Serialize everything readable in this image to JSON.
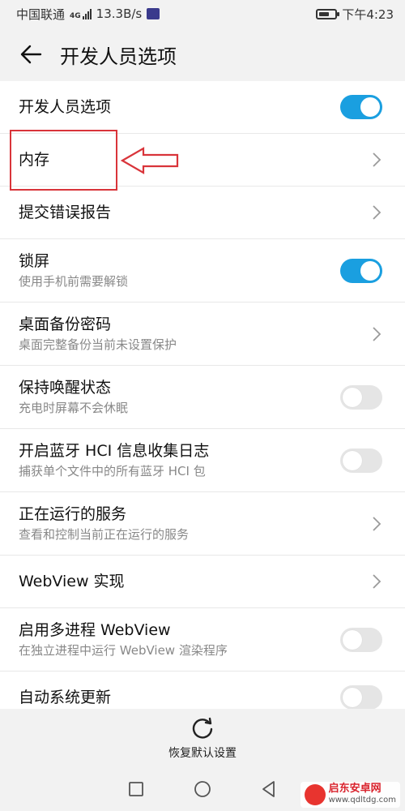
{
  "status_bar": {
    "carrier": "中国联通",
    "network_type": "4G",
    "net_speed": "13.3B/s",
    "time": "下午4:23"
  },
  "app_bar": {
    "title": "开发人员选项"
  },
  "settings": [
    {
      "title": "开发人员选项",
      "subtitle": "",
      "control": "switch",
      "state": "on"
    },
    {
      "title": "内存",
      "subtitle": "",
      "control": "chevron"
    },
    {
      "title": "提交错误报告",
      "subtitle": "",
      "control": "chevron"
    },
    {
      "title": "锁屏",
      "subtitle": "使用手机前需要解锁",
      "control": "switch",
      "state": "on"
    },
    {
      "title": "桌面备份密码",
      "subtitle": "桌面完整备份当前未设置保护",
      "control": "chevron"
    },
    {
      "title": "保持唤醒状态",
      "subtitle": "充电时屏幕不会休眠",
      "control": "switch",
      "state": "off"
    },
    {
      "title": "开启蓝牙 HCI 信息收集日志",
      "subtitle": "捕获单个文件中的所有蓝牙 HCI 包",
      "control": "switch",
      "state": "off"
    },
    {
      "title": "正在运行的服务",
      "subtitle": "查看和控制当前正在运行的服务",
      "control": "chevron"
    },
    {
      "title": "WebView 实现",
      "subtitle": "",
      "control": "chevron"
    },
    {
      "title": "启用多进程 WebView",
      "subtitle": "在独立进程中运行 WebView 渲染程序",
      "control": "switch",
      "state": "off"
    },
    {
      "title": "自动系统更新",
      "subtitle": "",
      "control": "switch",
      "state": "off"
    }
  ],
  "bottom_action": {
    "label": "恢复默认设置",
    "icon": "refresh-icon"
  },
  "nav_bar": {
    "icons": [
      "recents-square-icon",
      "home-circle-icon",
      "back-triangle-icon"
    ]
  },
  "watermark": {
    "name": "启东安卓网",
    "url": "www.qdltdg.com"
  },
  "colors": {
    "accent": "#1a9fe0",
    "annotation_red": "#d9343a",
    "background_gray": "#f2f2f2"
  }
}
